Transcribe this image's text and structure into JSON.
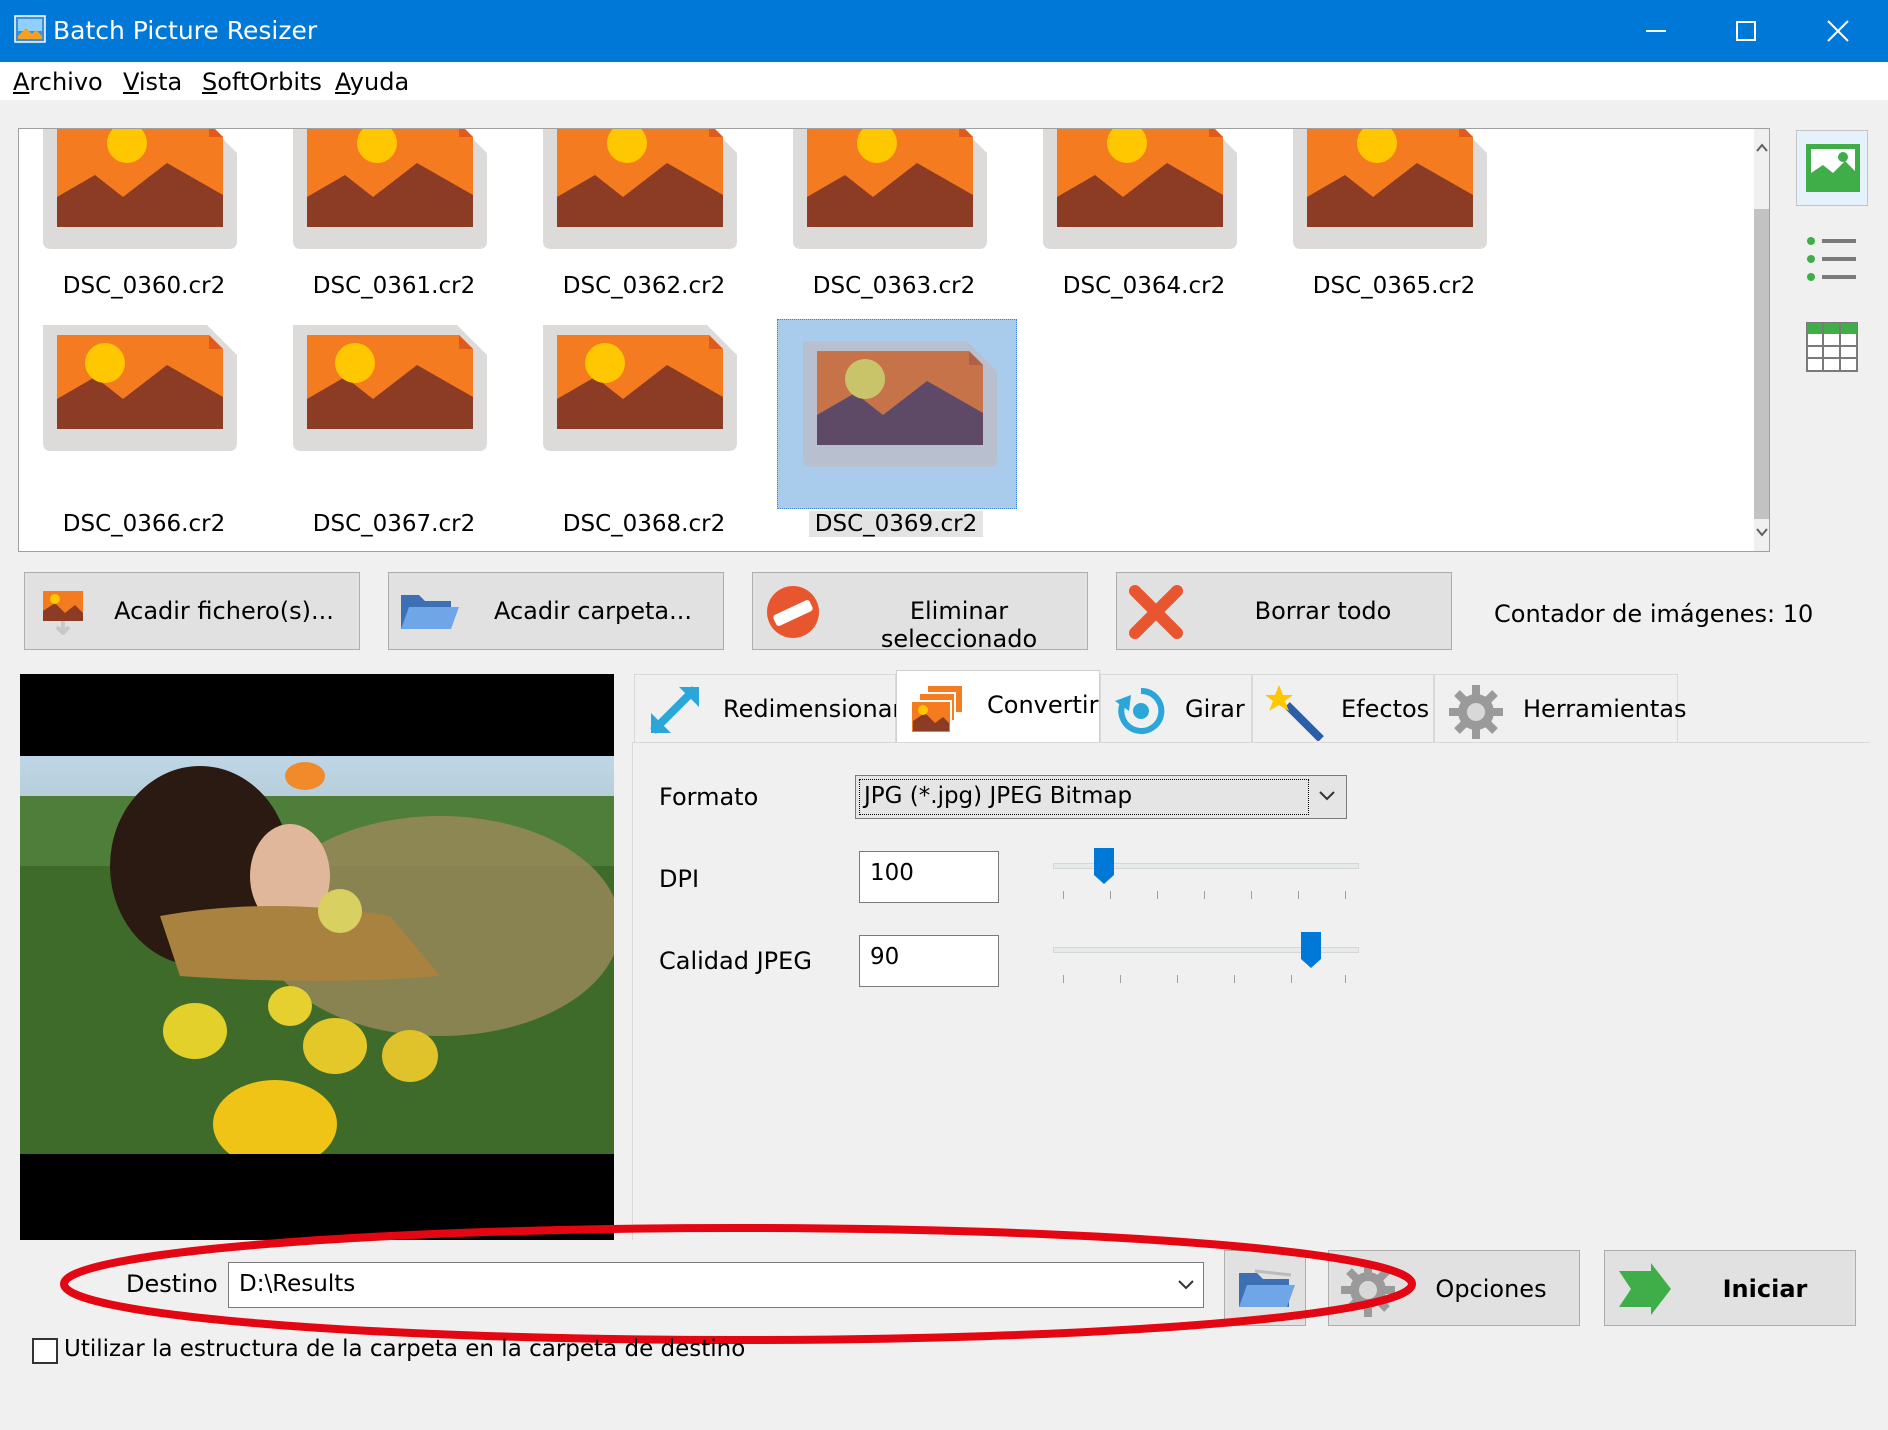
{
  "window": {
    "title": "Batch Picture Resizer"
  },
  "menu": {
    "items": [
      "Archivo",
      "Vista",
      "SoftOrbits",
      "Ayuda"
    ]
  },
  "thumbnails": [
    {
      "name": "DSC_0360.cr2"
    },
    {
      "name": "DSC_0361.cr2"
    },
    {
      "name": "DSC_0362.cr2"
    },
    {
      "name": "DSC_0363.cr2"
    },
    {
      "name": "DSC_0364.cr2"
    },
    {
      "name": "DSC_0365.cr2"
    },
    {
      "name": "DSC_0366.cr2"
    },
    {
      "name": "DSC_0367.cr2"
    },
    {
      "name": "DSC_0368.cr2"
    },
    {
      "name": "DSC_0369.cr2",
      "selected": true
    }
  ],
  "actions": {
    "add_files": "Acadir fichero(s)...",
    "add_folder": "Acadir carpeta...",
    "remove_selected": "Eliminar seleccionado",
    "clear_all": "Borrar todo",
    "counter": "Contador de imágenes: 10"
  },
  "tabs": [
    {
      "label": "Redimensionar"
    },
    {
      "label": "Convertir",
      "active": true
    },
    {
      "label": "Girar"
    },
    {
      "label": "Efectos"
    },
    {
      "label": "Herramientas"
    }
  ],
  "convert": {
    "format_label": "Formato",
    "format_value": "JPG (*.jpg) JPEG Bitmap",
    "dpi_label": "DPI",
    "dpi_value": "100",
    "dpi_slider": 0.14,
    "quality_label": "Calidad JPEG",
    "quality_value": "90",
    "quality_slider": 0.87
  },
  "destination": {
    "label": "Destino",
    "value": "D:\\Results"
  },
  "buttons": {
    "options": "Opciones",
    "start": "Iniciar"
  },
  "checkbox": {
    "label": "Utilizar la estructura de la carpeta en la carpeta de destino",
    "checked": false
  },
  "colors": {
    "titlebar": "#0078d7",
    "thumb_orange": "#f47b20",
    "thumb_brown": "#8c3b24",
    "thumb_sun": "#fec700",
    "highlight_ellipse": "#e30613",
    "accent_green": "#3fae49"
  },
  "icons": {
    "app": "picture-resizer-icon",
    "view_thumbnails": "image-thumbnails-icon",
    "view_list": "list-icon",
    "view_table": "table-icon"
  }
}
